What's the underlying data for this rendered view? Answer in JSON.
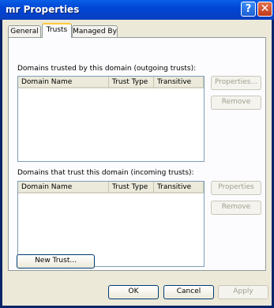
{
  "window": {
    "title": "mr Properties",
    "help_glyph": "?",
    "close_glyph": "✕"
  },
  "tabs": [
    {
      "label": "General"
    },
    {
      "label": "Trusts"
    },
    {
      "label": "Managed By"
    }
  ],
  "outgoing": {
    "label": "Domains trusted by this domain (outgoing trusts):",
    "columns": [
      "Domain Name",
      "Trust Type",
      "Transitive"
    ],
    "properties_label": "Properties...",
    "remove_label": "Remove"
  },
  "incoming": {
    "label": "Domains that trust this domain (incoming trusts):",
    "columns": [
      "Domain Name",
      "Trust Type",
      "Transitive"
    ],
    "properties_label": "Properties",
    "remove_label": "Remove"
  },
  "new_trust_label": "New Trust...",
  "footer": {
    "ok_label": "OK",
    "cancel_label": "Cancel",
    "apply_label": "Apply"
  }
}
